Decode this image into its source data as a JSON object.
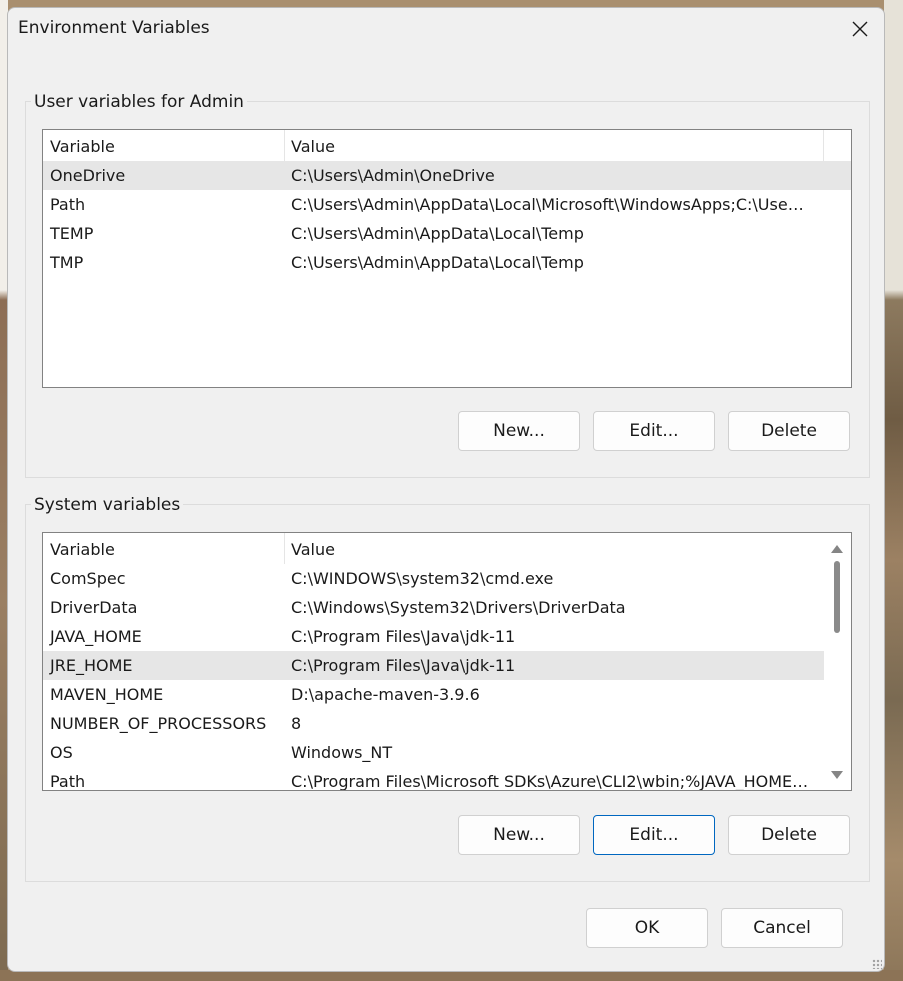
{
  "window": {
    "title": "Environment Variables",
    "close_icon": "close-icon"
  },
  "user_vars": {
    "group_label": "User variables for Admin",
    "headers": {
      "variable": "Variable",
      "value": "Value"
    },
    "rows": [
      {
        "variable": "OneDrive",
        "value": "C:\\Users\\Admin\\OneDrive",
        "selected": true
      },
      {
        "variable": "Path",
        "value": "C:\\Users\\Admin\\AppData\\Local\\Microsoft\\WindowsApps;C:\\Use…",
        "selected": false
      },
      {
        "variable": "TEMP",
        "value": "C:\\Users\\Admin\\AppData\\Local\\Temp",
        "selected": false
      },
      {
        "variable": "TMP",
        "value": "C:\\Users\\Admin\\AppData\\Local\\Temp",
        "selected": false
      }
    ],
    "buttons": {
      "new": "New...",
      "edit": "Edit...",
      "delete": "Delete"
    }
  },
  "system_vars": {
    "group_label": "System variables",
    "headers": {
      "variable": "Variable",
      "value": "Value"
    },
    "rows": [
      {
        "variable": "ComSpec",
        "value": "C:\\WINDOWS\\system32\\cmd.exe",
        "selected": false
      },
      {
        "variable": "DriverData",
        "value": "C:\\Windows\\System32\\Drivers\\DriverData",
        "selected": false
      },
      {
        "variable": "JAVA_HOME",
        "value": "C:\\Program Files\\Java\\jdk-11",
        "selected": false
      },
      {
        "variable": "JRE_HOME",
        "value": "C:\\Program Files\\Java\\jdk-11",
        "selected": true
      },
      {
        "variable": "MAVEN_HOME",
        "value": "D:\\apache-maven-3.9.6",
        "selected": false
      },
      {
        "variable": "NUMBER_OF_PROCESSORS",
        "value": "8",
        "selected": false
      },
      {
        "variable": "OS",
        "value": "Windows_NT",
        "selected": false
      },
      {
        "variable": "Path",
        "value": "C:\\Program Files\\Microsoft SDKs\\Azure\\CLI2\\wbin;%JAVA_HOME…",
        "selected": false
      }
    ],
    "buttons": {
      "new": "New...",
      "edit": "Edit...",
      "delete": "Delete"
    }
  },
  "footer": {
    "ok": "OK",
    "cancel": "Cancel"
  },
  "colors": {
    "accent": "#0067c0",
    "selection": "#e6e6e6",
    "dialog_bg": "#f0f0f0"
  }
}
